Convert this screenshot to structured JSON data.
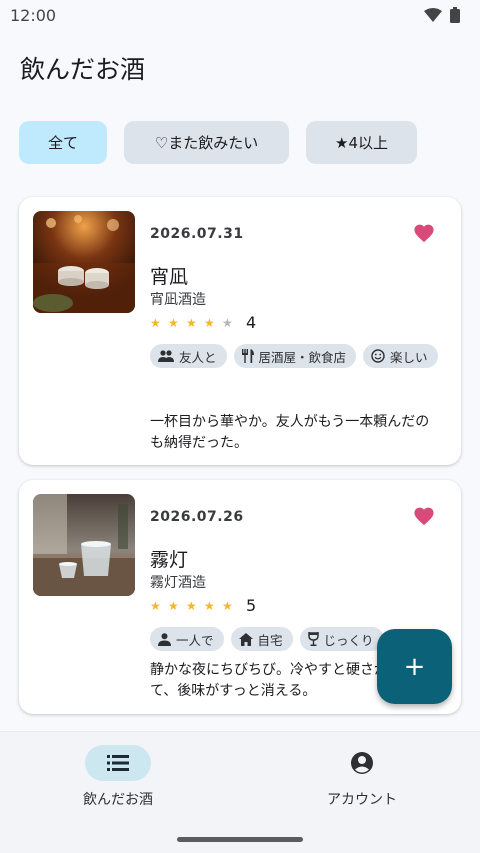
{
  "status_bar": {
    "time": "12:00"
  },
  "header": {
    "title": "飲んだお酒"
  },
  "filters": [
    {
      "label": "全て",
      "selected": true
    },
    {
      "label": "♡また飲みたい",
      "selected": false
    },
    {
      "label": "★4以上",
      "selected": false
    }
  ],
  "entries": [
    {
      "date": "2026.07.31",
      "name": "宵凪",
      "brewery": "宵凪酒造",
      "rating": 4,
      "rating_text": "4",
      "favorite": true,
      "tags": [
        {
          "icon": "people-icon",
          "label": "友人と"
        },
        {
          "icon": "restaurant-icon",
          "label": "居酒屋・飲食店"
        },
        {
          "icon": "smile-icon",
          "label": "楽しい"
        }
      ],
      "comment": "一杯目から華やか。友人がもう一本頼んだのも納得だった。"
    },
    {
      "date": "2026.07.26",
      "name": "霧灯",
      "brewery": "霧灯酒造",
      "rating": 5,
      "rating_text": "5",
      "favorite": true,
      "tags": [
        {
          "icon": "person-icon",
          "label": "一人で"
        },
        {
          "icon": "home-icon",
          "label": "自宅"
        },
        {
          "icon": "wine-glass-icon",
          "label": "じっくり"
        }
      ],
      "comment": "静かな夜にちびちび。冷やすと硬さが取れて、後味がすっと消える。"
    }
  ],
  "fab": {
    "label": "+"
  },
  "bottom_nav": [
    {
      "icon": "list-icon",
      "label": "飲んだお酒",
      "active": true
    },
    {
      "icon": "account-icon",
      "label": "アカウント",
      "active": false
    }
  ],
  "colors": {
    "accent": "#0b6177",
    "heart": "#d94a7b",
    "star": "#f2b825",
    "selected_chip": "#bfe9fd"
  }
}
